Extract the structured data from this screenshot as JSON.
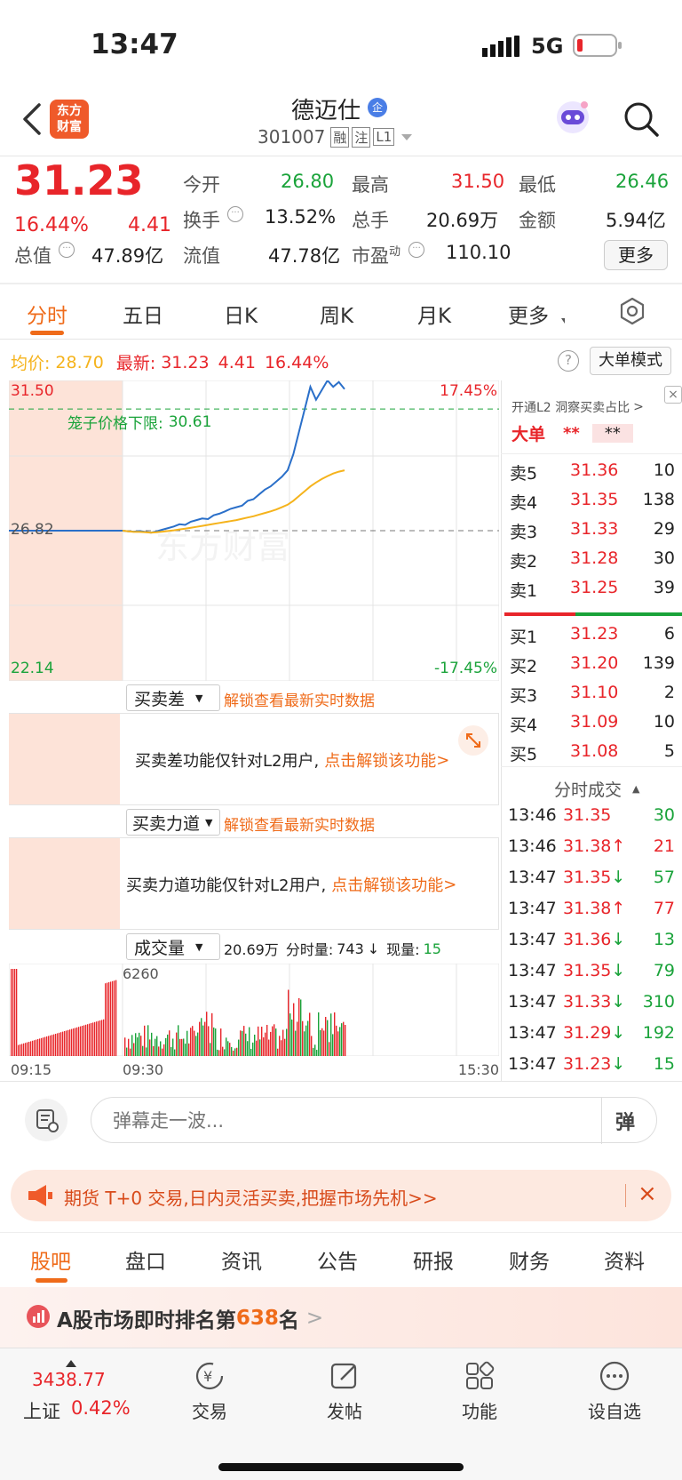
{
  "status_bar": {
    "time": "13:47",
    "network": "5G"
  },
  "header": {
    "logo_text": [
      "东方",
      "财富"
    ],
    "stock_name": "德迈仕",
    "badge": "企",
    "stock_code": "301007",
    "tags": [
      "融",
      "注",
      "L1"
    ]
  },
  "quote": {
    "price": "31.23",
    "change_pct": "16.44%",
    "change": "4.41",
    "fields": {
      "open_label": "今开",
      "open": "26.80",
      "high_label": "最高",
      "high": "31.50",
      "low_label": "最低",
      "low": "26.46",
      "turnover_label": "换手",
      "turnover": "13.52%",
      "volume_label": "总手",
      "volume": "20.69万",
      "amount_label": "金额",
      "amount": "5.94亿",
      "mktcap_label": "总值",
      "mktcap": "47.89亿",
      "float_label": "流值",
      "float": "47.78亿",
      "pe_label": "市盈",
      "pe_sup": "动",
      "pe": "110.10",
      "more_button": "更多"
    }
  },
  "chart_tabs": [
    "分时",
    "五日",
    "日K",
    "周K",
    "月K",
    "更多"
  ],
  "intraday": {
    "avg_label": "均价:",
    "avg": "28.70",
    "latest_label": "最新:",
    "latest": "31.23",
    "latest_chg": "4.41",
    "latest_pct": "16.44%",
    "big_order_button": "大单模式",
    "y_top": "31.50",
    "y_mid": "26.82",
    "y_bottom": "22.14",
    "pct_top": "17.45%",
    "pct_bottom": "-17.45%",
    "limit_label": "笼子价格下限:",
    "limit_value": "30.61",
    "watermark": "东方财富"
  },
  "chart_data": {
    "type": "line",
    "x_labels": [
      "09:15",
      "09:30",
      "15:30"
    ],
    "ylim": [
      22.14,
      31.5
    ],
    "reference_price": 26.82,
    "limit_price": 30.61,
    "series": [
      {
        "name": "最新",
        "values": [
          26.82,
          26.8,
          26.79,
          26.81,
          26.78,
          26.76,
          26.8,
          26.85,
          26.9,
          26.95,
          27.02,
          27.0,
          27.1,
          27.15,
          27.2,
          27.18,
          27.3,
          27.35,
          27.42,
          27.5,
          27.55,
          27.6,
          27.75,
          27.8,
          27.95,
          28.1,
          28.2,
          28.35,
          28.5,
          28.7,
          29.2,
          29.9,
          30.6,
          31.3,
          30.9,
          31.2,
          31.5,
          31.3,
          31.45,
          31.23
        ]
      },
      {
        "name": "均价",
        "values": [
          26.82,
          26.8,
          26.78,
          26.78,
          26.77,
          26.76,
          26.77,
          26.79,
          26.81,
          26.83,
          26.86,
          26.88,
          26.91,
          26.94,
          26.97,
          27.0,
          27.03,
          27.06,
          27.09,
          27.12,
          27.15,
          27.19,
          27.23,
          27.27,
          27.32,
          27.37,
          27.42,
          27.48,
          27.55,
          27.63,
          27.75,
          27.9,
          28.05,
          28.2,
          28.32,
          28.43,
          28.52,
          28.6,
          28.66,
          28.7
        ]
      }
    ]
  },
  "volume_panel": {
    "selector": "成交量",
    "total": "20.69万",
    "minute_label": "分时量:",
    "minute_value": "743",
    "current_label": "现量:",
    "current_value": "15",
    "max_label": "6260",
    "time_start": "09:15",
    "time_open": "09:30",
    "time_end": "15:30"
  },
  "lock_panels": [
    {
      "selector": "买卖差",
      "hint": "解锁查看最新实时数据",
      "message": "买卖差功能仅针对L2用户,",
      "link": "点击解锁该功能"
    },
    {
      "selector": "买卖力道",
      "hint": "解锁查看最新实时数据",
      "message": "买卖力道功能仅针对L2用户,",
      "link": "点击解锁该功能"
    }
  ],
  "order_book": {
    "promo": "开通L2 洞察买卖占比",
    "big_order_label": "大单",
    "big_order_value1": "**",
    "big_order_value2": "**",
    "asks": [
      {
        "label": "卖5",
        "price": "31.36",
        "vol": "10"
      },
      {
        "label": "卖4",
        "price": "31.35",
        "vol": "138"
      },
      {
        "label": "卖3",
        "price": "31.33",
        "vol": "29"
      },
      {
        "label": "卖2",
        "price": "31.28",
        "vol": "30"
      },
      {
        "label": "卖1",
        "price": "31.25",
        "vol": "39"
      }
    ],
    "bids": [
      {
        "label": "买1",
        "price": "31.23",
        "vol": "6"
      },
      {
        "label": "买2",
        "price": "31.20",
        "vol": "139"
      },
      {
        "label": "买3",
        "price": "31.10",
        "vol": "2"
      },
      {
        "label": "买4",
        "price": "31.09",
        "vol": "10"
      },
      {
        "label": "买5",
        "price": "31.08",
        "vol": "5"
      }
    ]
  },
  "ticks": {
    "title": "分时成交",
    "rows": [
      {
        "time": "13:46",
        "price": "31.35",
        "dir": "",
        "vol": "30",
        "vol_color": "green"
      },
      {
        "time": "13:46",
        "price": "31.38",
        "dir": "↑",
        "vol": "21",
        "vol_color": "red"
      },
      {
        "time": "13:47",
        "price": "31.35",
        "dir": "↓",
        "vol": "57",
        "vol_color": "green"
      },
      {
        "time": "13:47",
        "price": "31.38",
        "dir": "↑",
        "vol": "77",
        "vol_color": "red"
      },
      {
        "time": "13:47",
        "price": "31.36",
        "dir": "↓",
        "vol": "13",
        "vol_color": "green"
      },
      {
        "time": "13:47",
        "price": "31.35",
        "dir": "↓",
        "vol": "79",
        "vol_color": "green"
      },
      {
        "time": "13:47",
        "price": "31.33",
        "dir": "↓",
        "vol": "310",
        "vol_color": "green"
      },
      {
        "time": "13:47",
        "price": "31.29",
        "dir": "↓",
        "vol": "192",
        "vol_color": "green"
      },
      {
        "time": "13:47",
        "price": "31.23",
        "dir": "↓",
        "vol": "15",
        "vol_color": "green"
      }
    ]
  },
  "comment_bar": {
    "placeholder": "弹幕走一波...",
    "danmu_label": "弹"
  },
  "ad_banner": {
    "text": "期货 T+0 交易,日内灵活买卖,把握市场先机>>"
  },
  "bottom_tabs": [
    "股吧",
    "盘口",
    "资讯",
    "公告",
    "研报",
    "财务",
    "资料"
  ],
  "rank_banner": {
    "prefix": "A股市场即时排名第",
    "rank": "638",
    "suffix": "名"
  },
  "index_ticker": {
    "value": "3438.77",
    "name": "上证",
    "pct": "0.42%"
  },
  "bottom_nav": [
    {
      "label": "交易",
      "icon": "trade-icon"
    },
    {
      "label": "发帖",
      "icon": "post-icon"
    },
    {
      "label": "功能",
      "icon": "function-icon"
    },
    {
      "label": "设自选",
      "icon": "add-watchlist-icon"
    }
  ],
  "colors": {
    "up": "#e8252a",
    "down": "#1aa33a",
    "accent": "#ef6b1a",
    "price_line": "#2a6fc9",
    "avg_line": "#f5b31c"
  }
}
